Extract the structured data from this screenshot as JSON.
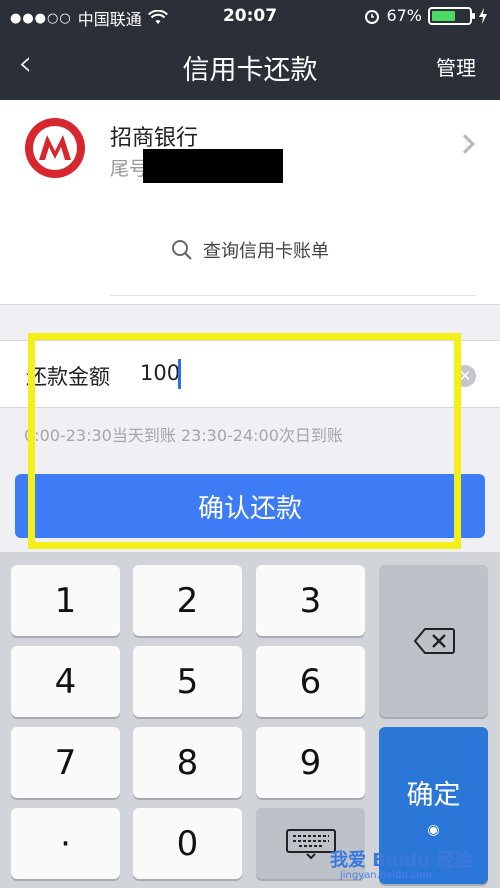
{
  "status_bar": {
    "signal_dots": "●●●○○",
    "carrier": "中国联通",
    "wifi_icon": "wifi-icon",
    "time": "20:07",
    "alarm_icon": "alarm-icon",
    "battery_percent": "67%",
    "battery_level": 0.67,
    "charging_icon": "charging-icon"
  },
  "nav": {
    "back_icon": "back-chevron-icon",
    "title": "信用卡还款",
    "manage": "管理"
  },
  "card": {
    "bank_name": "招商银行",
    "tail_label": "尾号",
    "query_link": "查询信用卡账单"
  },
  "amount": {
    "label": "还款金额",
    "value": "100"
  },
  "hint": "0:00-23:30当天到账  23:30-24:00次日到账",
  "confirm_button": "确认还款",
  "keyboard": {
    "keys": [
      "1",
      "2",
      "3",
      "4",
      "5",
      "6",
      "7",
      "8",
      "9",
      "·",
      "0"
    ],
    "ok_label": "确定"
  },
  "watermark": {
    "text": "我爱 Baidu 经验",
    "sub": "jingyan.baidu.com"
  },
  "colors": {
    "nav_bg": "#2b2f38",
    "accent_blue": "#3d7cf4",
    "bank_red": "#d7262d",
    "highlight_yellow": "#f4ee19",
    "battery_green": "#4cd964"
  }
}
